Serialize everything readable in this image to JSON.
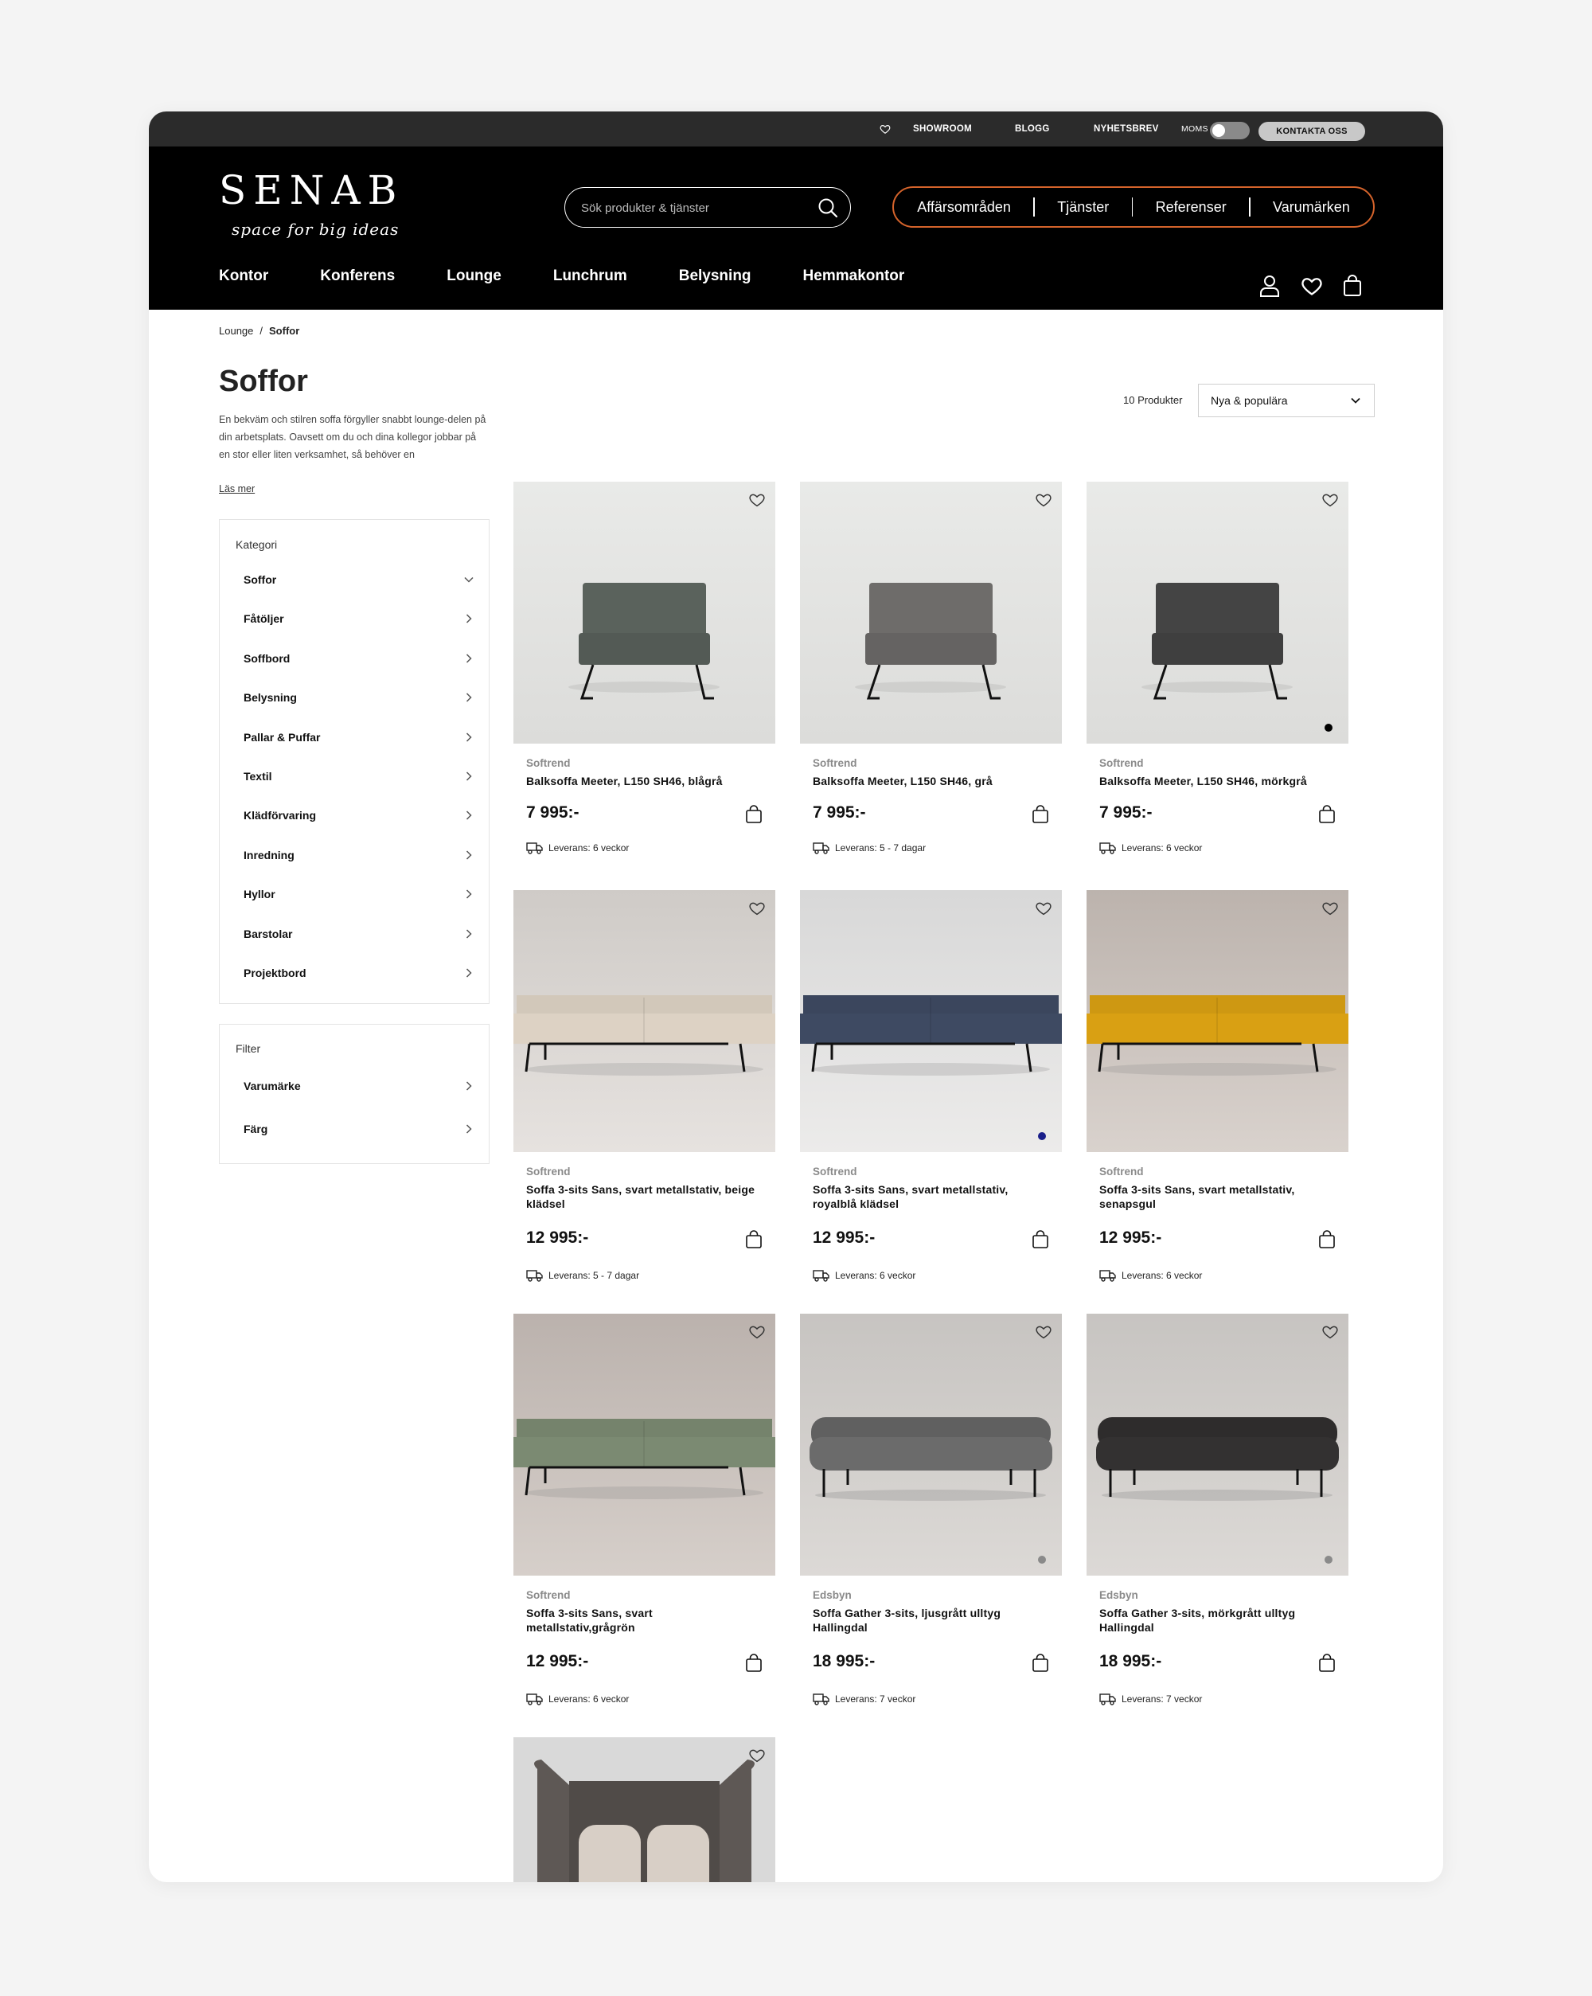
{
  "utility": {
    "showroom": "SHOWROOM",
    "blogg": "BLOGG",
    "nyhetsbrev": "NYHETSBREV",
    "moms": "MOMS",
    "contact": "KONTAKTA OSS"
  },
  "header": {
    "logo": "SENAB",
    "tagline": "space for big ideas",
    "search_placeholder": "Sök produkter & tjänster",
    "pill_nav": [
      "Affärsområden",
      "Tjänster",
      "Referenser",
      "Varumärken"
    ],
    "main_nav": [
      "Kontor",
      "Konferens",
      "Lounge",
      "Lunchrum",
      "Belysning",
      "Hemmakontor"
    ],
    "accent_color": "#d4632b"
  },
  "breadcrumb": {
    "parent": "Lounge",
    "current": "Soffor"
  },
  "page": {
    "title": "Soffor",
    "description": "En bekväm och stilren soffa förgyller snabbt lounge-delen på din arbetsplats. Oavsett om du och dina kollegor jobbar på en stor eller liten verksamhet, så behöver en",
    "read_more": "Läs mer",
    "product_count": "10 Produkter",
    "sort_selected": "Nya & populära"
  },
  "sidebar": {
    "category_heading": "Kategori",
    "categories": [
      "Soffor",
      "Fåtöljer",
      "Soffbord",
      "Belysning",
      "Pallar & Puffar",
      "Textil",
      "Klädförvaring",
      "Inredning",
      "Hyllor",
      "Barstolar",
      "Projektbord"
    ],
    "filter_heading": "Filter",
    "filters": [
      "Varumärke",
      "Färg"
    ]
  },
  "products": [
    {
      "brand": "Softrend",
      "name": "Balksoffa Meeter, L150 SH46, blågrå",
      "price": "7 995:-",
      "delivery": "Leverans: 6 veckor",
      "color": "#5a625c",
      "swatch": ""
    },
    {
      "brand": "Softrend",
      "name": "Balksoffa Meeter, L150 SH46, grå",
      "price": "7 995:-",
      "delivery": "Leverans: 5 - 7 dagar",
      "color": "#6e6c6a",
      "swatch": ""
    },
    {
      "brand": "Softrend",
      "name": "Balksoffa Meeter, L150 SH46, mörkgrå",
      "price": "7 995:-",
      "delivery": "Leverans: 6 veckor",
      "color": "#444444",
      "swatch": "#000000"
    },
    {
      "brand": "Softrend",
      "name": "Soffa 3-sits Sans, svart metallstativ, beige klädsel",
      "price": "12 995:-",
      "delivery": "Leverans: 5 - 7 dagar",
      "color": "#ddd2c4",
      "swatch": ""
    },
    {
      "brand": "Softrend",
      "name": "Soffa 3-sits Sans, svart metallstativ, royalblå klädsel",
      "price": "12 995:-",
      "delivery": "Leverans: 6 veckor",
      "color": "#3e4a62",
      "swatch": "#1a1f8a"
    },
    {
      "brand": "Softrend",
      "name": "Soffa 3-sits Sans, svart metallstativ, senapsgul",
      "price": "12 995:-",
      "delivery": "Leverans: 6 veckor",
      "color": "#d9a013",
      "swatch": ""
    },
    {
      "brand": "Softrend",
      "name": "Soffa 3-sits Sans, svart metallstativ,grågrön",
      "price": "12 995:-",
      "delivery": "Leverans: 6 veckor",
      "color": "#7b8a72",
      "swatch": ""
    },
    {
      "brand": "Edsbyn",
      "name": "Soffa Gather 3-sits, ljusgrått ulltyg Hallingdal",
      "price": "18 995:-",
      "delivery": "Leverans: 7 veckor",
      "color": "#6b6b6b",
      "swatch": "#8a8a8a"
    },
    {
      "brand": "Edsbyn",
      "name": "Soffa Gather 3-sits, mörkgrått ulltyg Hallingdal",
      "price": "18 995:-",
      "delivery": "Leverans: 7 veckor",
      "color": "#333131",
      "swatch": "#8a8a8a"
    },
    {
      "brand": "",
      "name": "",
      "price": "",
      "delivery": "",
      "color": "#5e5855",
      "swatch": ""
    }
  ]
}
